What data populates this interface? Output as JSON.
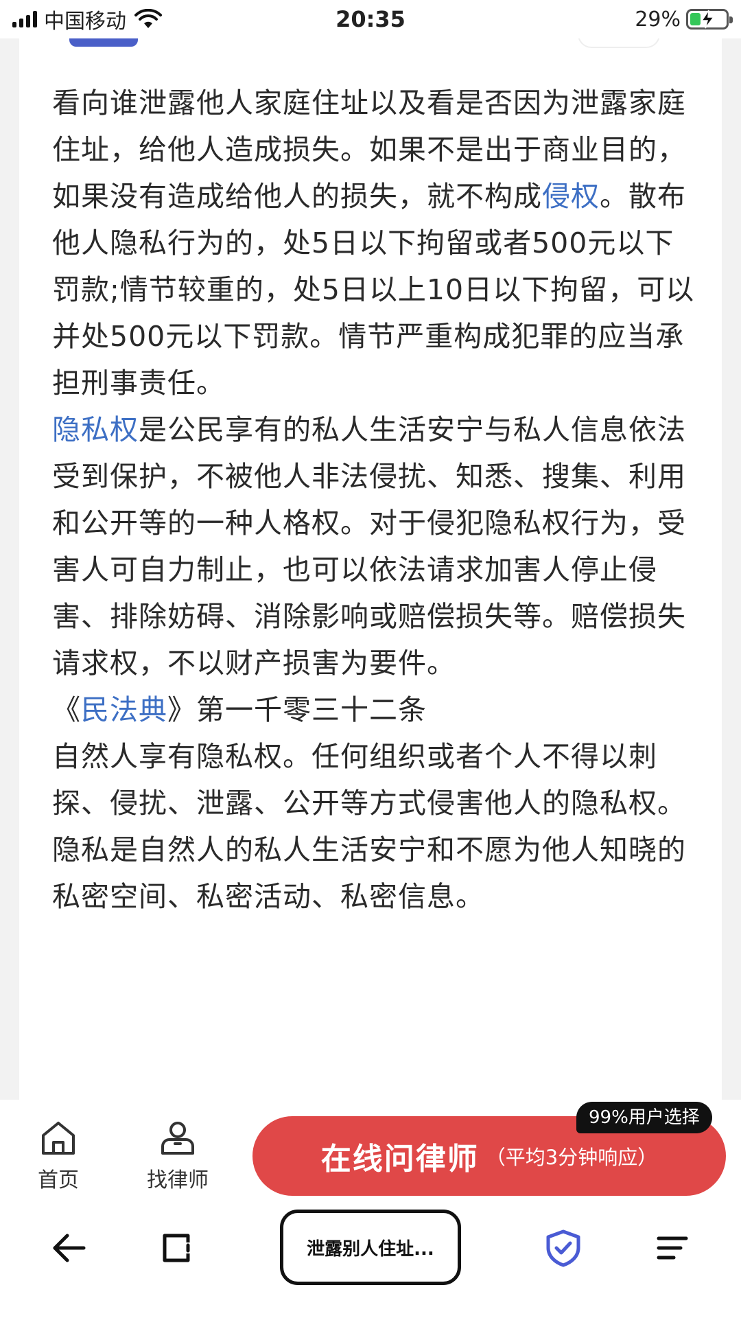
{
  "status_bar": {
    "carrier": "中国移动",
    "time": "20:35",
    "battery_percent": "29%",
    "battery_level": 0.29,
    "icons": [
      "signal-icon",
      "wifi-icon",
      "battery-charging-icon"
    ]
  },
  "article": {
    "paragraph1": "看向谁泄露他人家庭住址以及看是否因为泄露家庭住址，给他人造成损失。如果不是出于商业目的，如果没有造成给他人的损失，就不构成",
    "link1": "侵权",
    "paragraph1_rest": "。散布他人隐私行为的，处5日以下拘留或者500元以下罚款;情节较重的，处5日以上10日以下拘留，可以并处500元以下罚款。情节严重构成犯罪的应当承担刑事责任。",
    "link2": "隐私权",
    "paragraph2_rest": "是公民享有的私人生活安宁与私人信息依法受到保护，不被他人非法侵扰、知悉、搜集、利用和公开等的一种人格权。对于侵犯隐私权行为，受害人可自力制止，也可以依法请求加害人停止侵害、排除妨碍、消除影响或赔偿损失等。赔偿损失请求权，不以财产损害为要件。",
    "law_prefix": "《",
    "link3": "民法典",
    "law_suffix": "》第一千零三十二条",
    "paragraph3": "自然人享有隐私权。任何组织或者个人不得以刺探、侵扰、泄露、公开等方式侵害他人的隐私权。",
    "paragraph4": "隐私是自然人的私人生活安宁和不愿为他人知晓的私密空间、私密活动、私密信息。",
    "link_color": "#3d6fc4"
  },
  "bottom_nav": {
    "home_label": "首页",
    "lawyer_label": "找律师",
    "cta_main": "在线问律师",
    "cta_sub": "（平均3分钟响应）",
    "cta_badge": "99%用户选择",
    "cta_color": "#e04848",
    "icons": [
      "home-icon",
      "lawyer-icon"
    ]
  },
  "browser_bar": {
    "url_title": "泄露别人住址...",
    "icons": [
      "back-arrow-icon",
      "tabs-icon",
      "shield-check-icon",
      "menu-icon"
    ],
    "shield_color": "#4a5bd4"
  }
}
